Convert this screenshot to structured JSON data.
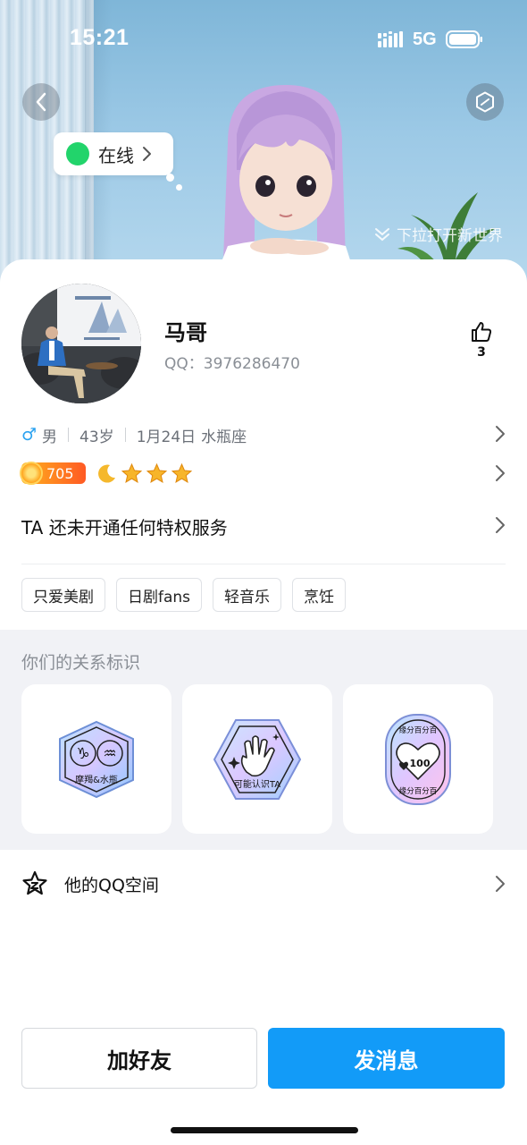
{
  "status_bar": {
    "time": "15:21",
    "network": "5G"
  },
  "banner": {
    "online_status": "在线",
    "pull_hint": "下拉打开新世界"
  },
  "profile": {
    "name": "马哥",
    "qq_label": "QQ：",
    "qq_number": "3976286470",
    "like_count": "3",
    "gender": "男",
    "age": "43岁",
    "birthday": "1月24日",
    "zodiac": "水瓶座",
    "level": "705",
    "privilege_text": "TA 还未开通任何特权服务"
  },
  "tags": [
    "只爱美剧",
    "日剧fans",
    "轻音乐",
    "烹饪"
  ],
  "relation": {
    "title": "你们的关系标识",
    "badges": [
      {
        "label": "摩羯&水瓶",
        "icon": "zodiac-badge-icon"
      },
      {
        "label": "可能认识TA",
        "icon": "wave-hand-badge-icon"
      },
      {
        "label": "缘分百分百",
        "icon": "heart-100-badge-icon"
      }
    ]
  },
  "qzone": {
    "label": "他的QQ空间"
  },
  "actions": {
    "add_friend": "加好友",
    "send_message": "发消息"
  },
  "colors": {
    "accent": "#129bf8",
    "online": "#22d46b",
    "male": "#2ba2f0"
  }
}
